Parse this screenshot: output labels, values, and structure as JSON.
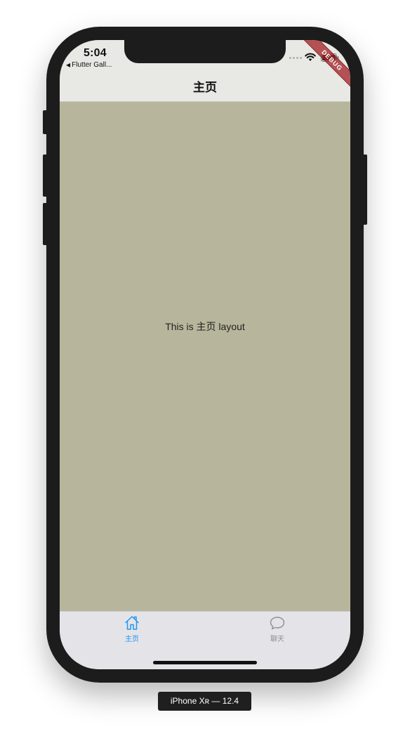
{
  "status_bar": {
    "time": "5:04",
    "back_app": "Flutter Gall...",
    "back_arrow": "◀",
    "debug_banner": "DEBUG"
  },
  "app_bar": {
    "title": "主页"
  },
  "body": {
    "text": "This is 主页 layout"
  },
  "tabs": [
    {
      "label": "主页",
      "icon": "home-icon",
      "active": true
    },
    {
      "label": "聊天",
      "icon": "chat-bubble-icon",
      "active": false
    }
  ],
  "device_label": "iPhone Xʀ — 12.4",
  "colors": {
    "content_background": "#b7b59b",
    "bar_background": "#e8e8e4",
    "tab_active": "#2196f3",
    "tab_inactive": "#8e8e93",
    "debug_ribbon": "#a4262c"
  }
}
